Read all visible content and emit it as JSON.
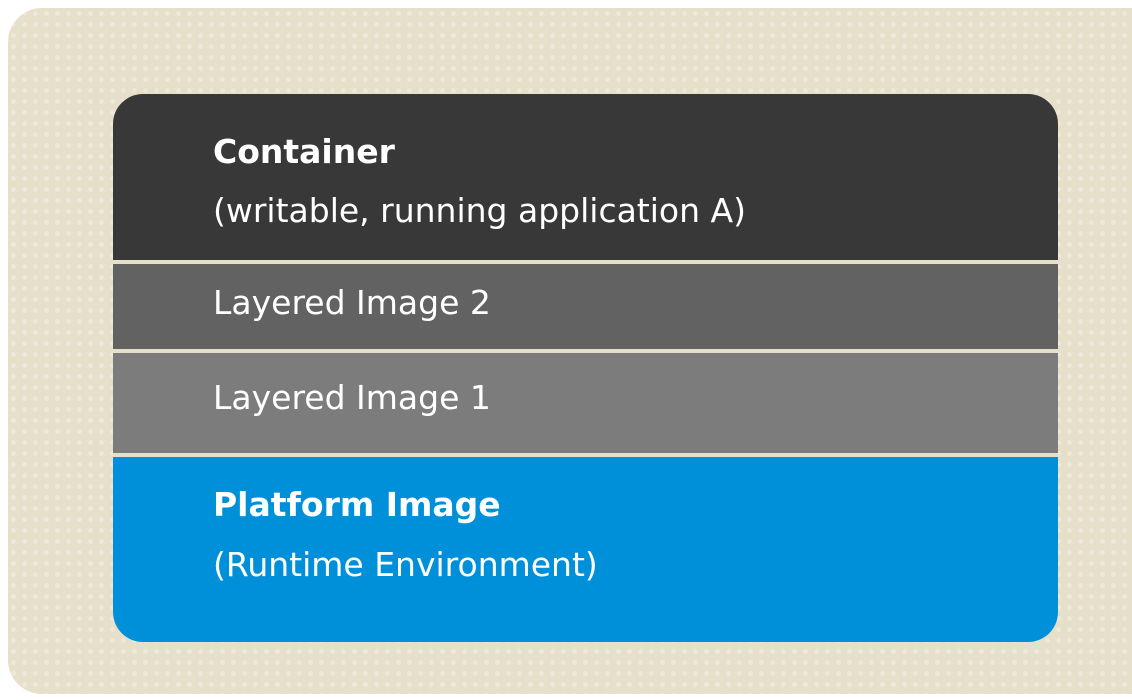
{
  "diagram": {
    "layers": [
      {
        "title": "Container",
        "subtitle": "(writable, running application A)",
        "color": "#383838"
      },
      {
        "title": "",
        "subtitle": "Layered Image 2",
        "color": "#626262"
      },
      {
        "title": "",
        "subtitle": "Layered Image 1",
        "color": "#7c7c7c"
      },
      {
        "title": "Platform Image",
        "subtitle": "(Runtime Environment)",
        "color": "#0090da"
      }
    ],
    "background_color": "#e6dfca"
  }
}
